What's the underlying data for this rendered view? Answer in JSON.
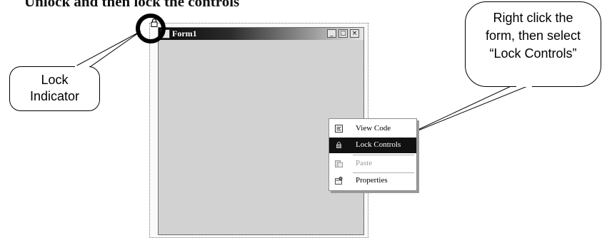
{
  "heading": "Unlock and then lock the controls",
  "form": {
    "title": "Form1",
    "minimize": "_",
    "maximize": "□",
    "close": "×"
  },
  "callouts": {
    "lock_indicator": [
      "Lock",
      "Indicator"
    ],
    "instruction": [
      "Right click the",
      "form, then select",
      "“Lock Controls”"
    ]
  },
  "context_menu": {
    "items": [
      {
        "label": "View Code",
        "icon": "view-code-icon",
        "state": "normal"
      },
      {
        "label": "Lock Controls",
        "icon": "lock-icon",
        "state": "highlighted"
      },
      {
        "label": "Paste",
        "icon": "paste-icon",
        "state": "disabled"
      },
      {
        "label": "Properties",
        "icon": "properties-icon",
        "state": "normal"
      }
    ]
  },
  "colors": {
    "form_background": "#d2d2d2",
    "highlight": "#111111",
    "disabled_text": "#9a9a9a"
  }
}
